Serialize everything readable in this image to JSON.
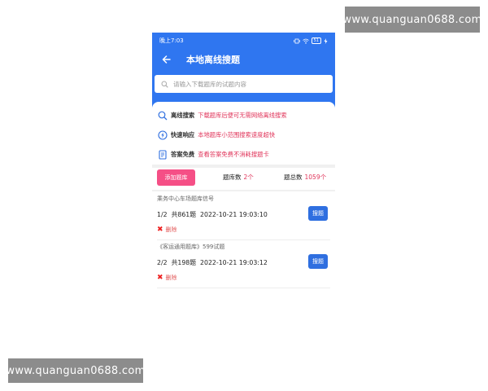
{
  "watermark_top": "www.quanguan0688.com",
  "watermark_bottom": "www.quanguan0688.com",
  "status_bar": {
    "time": "晚上7:03",
    "battery": "51"
  },
  "header": {
    "title": "本地离线搜题"
  },
  "search": {
    "placeholder": "请输入下载题库的试题内容"
  },
  "features": [
    {
      "icon": "search-icon",
      "label": "离线搜索",
      "desc": "下载题库后便可无需网络离线搜索"
    },
    {
      "icon": "lightning-icon",
      "label": "快速响应",
      "desc": "本地题库小范围搜索速度超快"
    },
    {
      "icon": "answer-sheet-icon",
      "label": "答案免费",
      "desc": "查看答案免费不消耗搜题卡"
    }
  ],
  "stats": {
    "add_label": "添加题库",
    "bank_count_label": "题库数",
    "bank_count": "2个",
    "total_label": "题总数",
    "total": "1059个"
  },
  "banks": [
    {
      "name": "乘务中心车场题库信号",
      "progress": "1/2",
      "count": "共861题",
      "date": "2022-10-21 19:03:10",
      "search_label": "搜题",
      "delete_label": "删除"
    },
    {
      "name": "《客运通用题库》599试题",
      "progress": "2/2",
      "count": "共198题",
      "date": "2022-10-21 19:03:12",
      "search_label": "搜题",
      "delete_label": "删除"
    }
  ],
  "colors": {
    "primary": "#2f76f0",
    "accent": "#e0345a",
    "add_button": "#f54f86",
    "item_button": "#2f6fe0"
  }
}
